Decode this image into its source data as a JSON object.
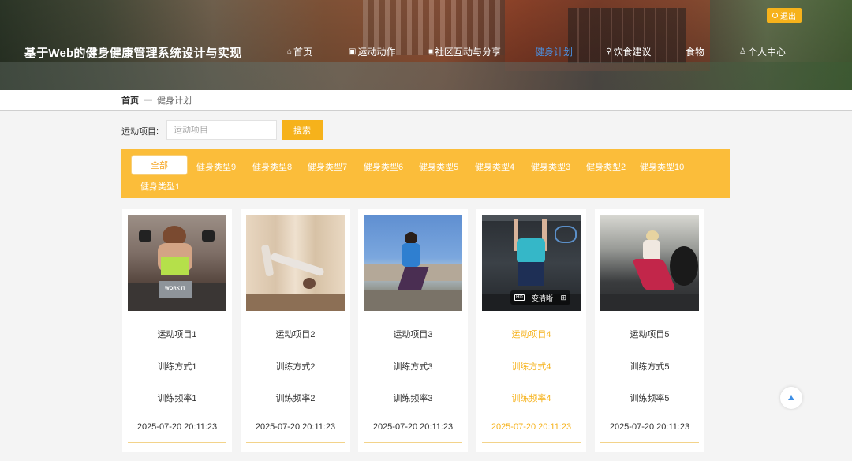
{
  "header": {
    "site_title": "基于Web的健身健康管理系统设计与实现",
    "logout_label": "退出",
    "nav": [
      {
        "label": "首页",
        "icon": "home-icon"
      },
      {
        "label": "运动动作",
        "icon": "video-icon"
      },
      {
        "label": "社区互动与分享",
        "icon": "square-icon"
      },
      {
        "label": "健身计划",
        "icon": "",
        "active": true
      },
      {
        "label": "饮食建议",
        "icon": "bike-icon"
      },
      {
        "label": "食物",
        "icon": ""
      },
      {
        "label": "个人中心",
        "icon": "user-icon"
      }
    ]
  },
  "breadcrumb": {
    "home": "首页",
    "sep": "—",
    "current": "健身计划"
  },
  "search": {
    "label": "运动项目:",
    "placeholder": "运动项目",
    "button": "搜索"
  },
  "categories": [
    "全部",
    "健身类型9",
    "健身类型8",
    "健身类型7",
    "健身类型6",
    "健身类型5",
    "健身类型4",
    "健身类型3",
    "健身类型2",
    "健身类型10",
    "健身类型1"
  ],
  "cards": [
    {
      "name": "运动项目1",
      "method": "训练方式1",
      "freq": "训练频率1",
      "time": "2025-07-20 20:11:23",
      "highlight": false
    },
    {
      "name": "运动项目2",
      "method": "训练方式2",
      "freq": "训练频率2",
      "time": "2025-07-20 20:11:23",
      "highlight": false
    },
    {
      "name": "运动项目3",
      "method": "训练方式3",
      "freq": "训练频率3",
      "time": "2025-07-20 20:11:23",
      "highlight": false
    },
    {
      "name": "运动项目4",
      "method": "训练方式4",
      "freq": "训练频率4",
      "time": "2025-07-20 20:11:23",
      "highlight": true,
      "overlay": "变清晰"
    },
    {
      "name": "运动项目5",
      "method": "训练方式5",
      "freq": "训练频率5",
      "time": "2025-07-20 20:11:23",
      "highlight": false
    }
  ],
  "image_badges": {
    "card1_shorts": "WORK IT"
  },
  "colors": {
    "accent": "#f6b21b",
    "category_bar": "#fbbd3a",
    "nav_active": "#4a90e2",
    "to_top_arrow": "#3c8ee5"
  }
}
